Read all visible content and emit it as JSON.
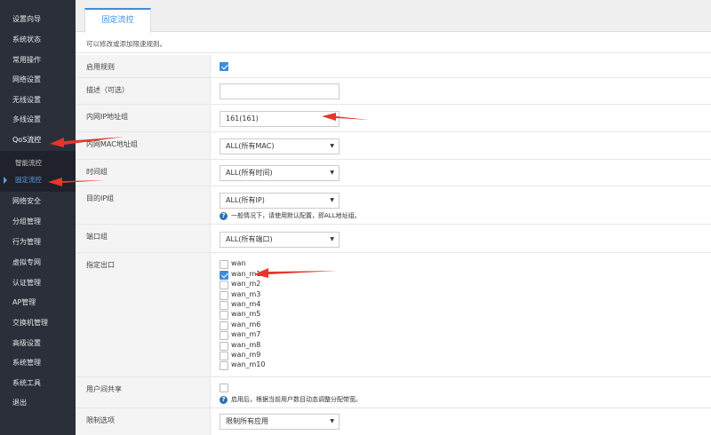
{
  "sidebar": {
    "items": [
      {
        "label": "设置向导"
      },
      {
        "label": "系统状态"
      },
      {
        "label": "常用操作"
      },
      {
        "label": "网络设置"
      },
      {
        "label": "无线设置"
      },
      {
        "label": "多线设置"
      },
      {
        "label": "QoS流控"
      },
      {
        "label": "网络安全"
      },
      {
        "label": "分组管理"
      },
      {
        "label": "行为管理"
      },
      {
        "label": "虚拟专网"
      },
      {
        "label": "认证管理"
      },
      {
        "label": "AP管理"
      },
      {
        "label": "交换机管理"
      },
      {
        "label": "高级设置"
      },
      {
        "label": "系统管理"
      },
      {
        "label": "系统工具"
      },
      {
        "label": "退出"
      }
    ],
    "submenu": [
      {
        "label": "智能流控"
      },
      {
        "label": "固定流控"
      }
    ]
  },
  "tab": {
    "label": "固定流控"
  },
  "hint": "可以修改或添加限速规则。",
  "form": {
    "enable": {
      "label": "启用规则",
      "checked": true
    },
    "description": {
      "label": "描述（可选）",
      "value": ""
    },
    "lan_ip_group": {
      "label": "内网IP地址组",
      "value": "161(161)"
    },
    "lan_mac_group": {
      "label": "内网MAC地址组",
      "value": "ALL(所有MAC)"
    },
    "time_group": {
      "label": "时间组",
      "value": "ALL(所有时间)"
    },
    "dest_ip_group": {
      "label": "目的IP组",
      "value": "ALL(所有IP)",
      "help": "一般情况下，请使用默认配置，即ALL地址组。"
    },
    "port_group": {
      "label": "端口组",
      "value": "ALL(所有端口)"
    },
    "egress": {
      "label": "指定出口",
      "interfaces": [
        {
          "name": "wan",
          "checked": false
        },
        {
          "name": "wan_m1",
          "checked": true
        },
        {
          "name": "wan_m2",
          "checked": false
        },
        {
          "name": "wan_m3",
          "checked": false
        },
        {
          "name": "wan_m4",
          "checked": false
        },
        {
          "name": "wan_m5",
          "checked": false
        },
        {
          "name": "wan_m6",
          "checked": false
        },
        {
          "name": "wan_m7",
          "checked": false
        },
        {
          "name": "wan_m8",
          "checked": false
        },
        {
          "name": "wan_m9",
          "checked": false
        },
        {
          "name": "wan_m10",
          "checked": false
        }
      ]
    },
    "share": {
      "label": "用户间共享",
      "checked": false,
      "help": "启用后，根据当前用户数目动态调整分配带宽。"
    },
    "limit_option": {
      "label": "限制选项",
      "value": "限制所有应用"
    }
  },
  "colors": {
    "sidebar_bg": "#2b2f3a",
    "accent": "#3c8dde",
    "arrow": "#e8352b"
  }
}
